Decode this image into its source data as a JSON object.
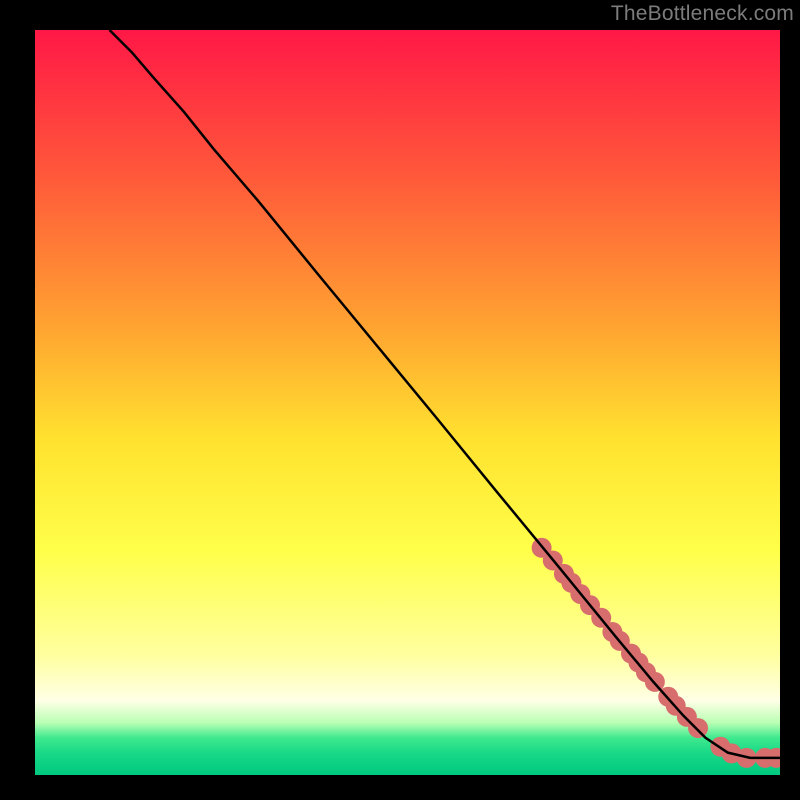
{
  "attribution": "TheBottleneck.com",
  "chart_data": {
    "type": "line",
    "title": "",
    "xlabel": "",
    "ylabel": "",
    "xlim": [
      0,
      100
    ],
    "ylim": [
      0,
      100
    ],
    "background_gradient": {
      "stops": [
        {
          "pct": 0,
          "color": "#ff1846"
        },
        {
          "pct": 20,
          "color": "#ff5a3a"
        },
        {
          "pct": 40,
          "color": "#ffa431"
        },
        {
          "pct": 55,
          "color": "#ffe22f"
        },
        {
          "pct": 70,
          "color": "#ffff4a"
        },
        {
          "pct": 84,
          "color": "#ffffa0"
        },
        {
          "pct": 90,
          "color": "#ffffe6"
        },
        {
          "pct": 93,
          "color": "#b9ffb4"
        },
        {
          "pct": 95,
          "color": "#3fe98e"
        },
        {
          "pct": 97,
          "color": "#19d987"
        },
        {
          "pct": 100,
          "color": "#00c97f"
        }
      ]
    },
    "series": [
      {
        "name": "curve",
        "type": "line",
        "x": [
          10,
          13,
          16,
          20,
          24,
          30,
          38,
          46,
          54,
          62,
          70,
          78,
          83,
          87,
          90,
          93,
          96,
          100
        ],
        "y": [
          100,
          97,
          93.5,
          89,
          84,
          77,
          67.2,
          57.5,
          47.8,
          38,
          28.3,
          18.5,
          12.5,
          8,
          5,
          3,
          2.3,
          2.3
        ],
        "color": "#000000",
        "stroke_width": 2.5
      },
      {
        "name": "dots",
        "type": "scatter",
        "x": [
          68,
          69.5,
          71,
          72,
          73.2,
          74.5,
          76,
          77.5,
          78.5,
          80,
          81,
          82,
          83.2,
          85,
          86,
          87.5,
          89,
          92,
          93.5,
          95.5,
          98,
          99.5
        ],
        "y": [
          30.5,
          28.8,
          27,
          25.8,
          24.3,
          22.8,
          21.1,
          19.2,
          18,
          16.3,
          15.1,
          13.8,
          12.5,
          10.5,
          9.3,
          7.8,
          6.3,
          3.8,
          2.9,
          2.3,
          2.3,
          2.3
        ],
        "color": "#d76d6d",
        "radius": 10
      }
    ]
  }
}
